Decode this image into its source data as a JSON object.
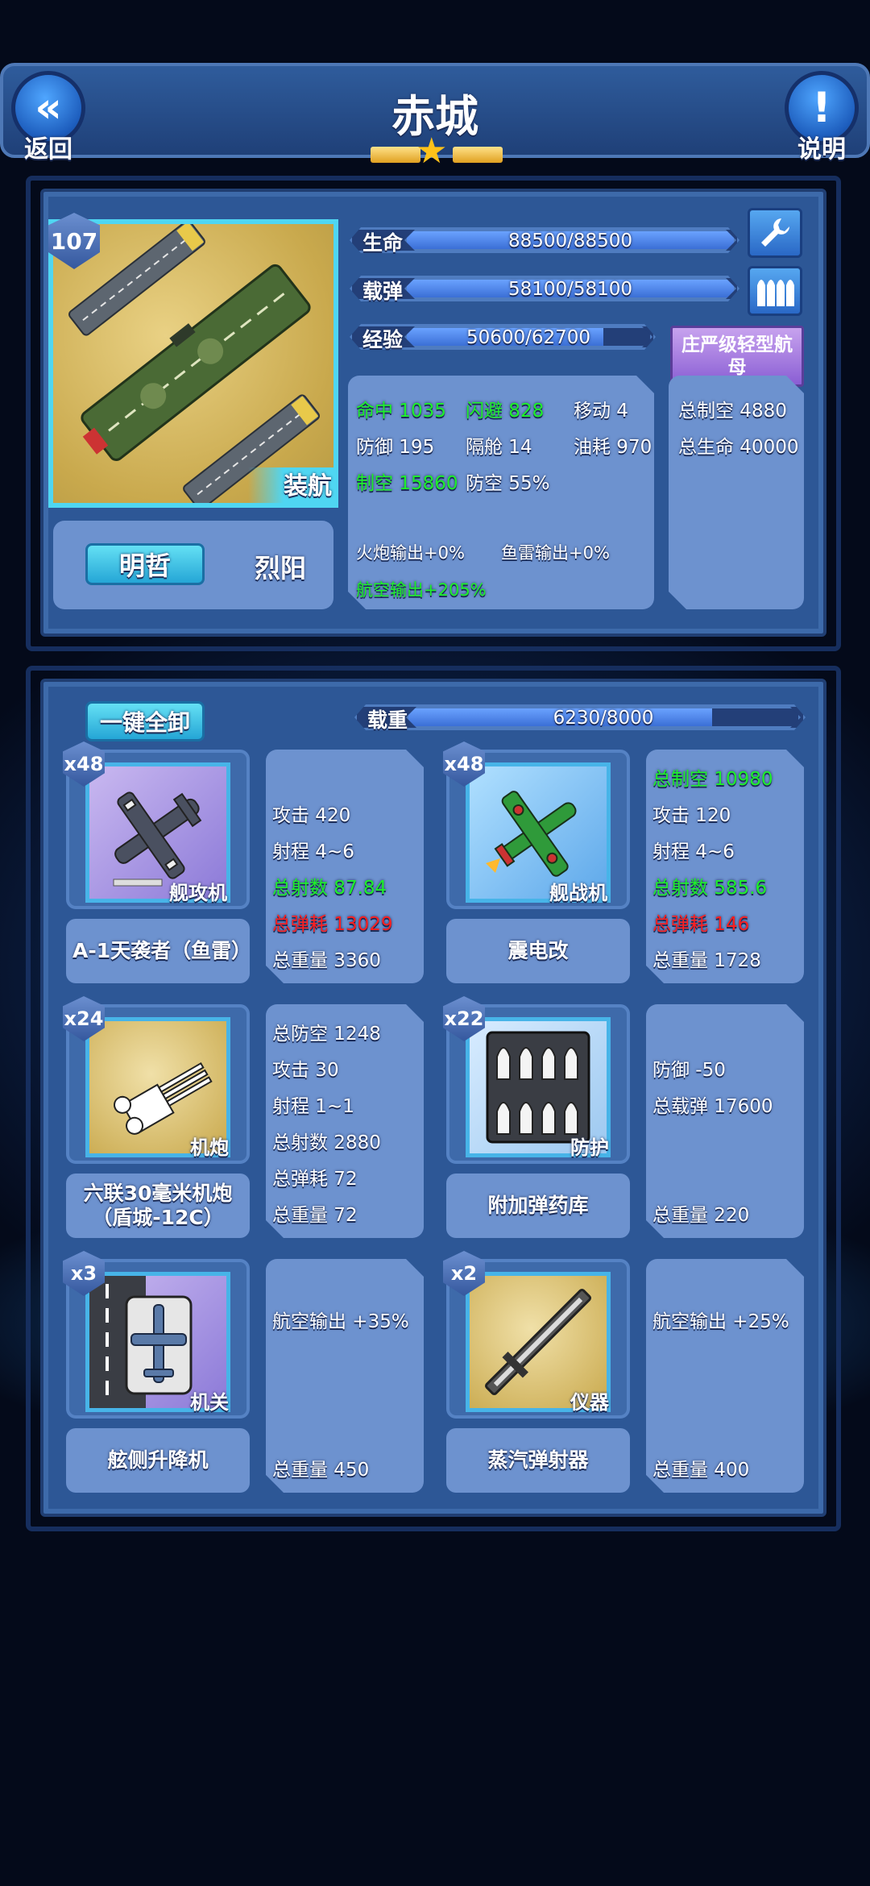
{
  "header": {
    "back_label": "返回",
    "title": "赤城",
    "help_label": "说明",
    "stars": 1
  },
  "ship": {
    "level": "107",
    "type_tag": "装航",
    "captain_btn": "明哲",
    "captain_name": "烈阳",
    "bars": {
      "hp": {
        "label": "生命",
        "text": "88500/88500",
        "fill": 1.0
      },
      "ammo": {
        "label": "载弹",
        "text": "58100/58100",
        "fill": 1.0
      },
      "exp": {
        "label": "经验",
        "text": "50600/62700",
        "fill": 0.807
      }
    },
    "class_btn": "庄严级轻型航母",
    "stats": {
      "hit": "命中 1035",
      "evade": "闪避 828",
      "move": "移动 4",
      "def": "防御 195",
      "bulkhead": "隔舱 14",
      "fuel": "油耗 970",
      "air": "制空 15860",
      "aa": "防空 55%",
      "gun_out": "火炮输出+0%",
      "torp_out": "鱼雷输出+0%",
      "air_out": "航空输出+205%"
    },
    "fleet": {
      "total_air": "总制空 4880",
      "total_hp": "总生命 40000"
    }
  },
  "loadout": {
    "unload_label": "一键全卸",
    "weight": {
      "label": "载重",
      "text": "6230/8000",
      "fill": 0.779
    },
    "items": [
      {
        "count": "x48",
        "category": "舰攻机",
        "name": "A-1天袭者（鱼雷）",
        "icon": "torpedo-bomber-icon",
        "stats": [
          {
            "t": "攻击 420",
            "c": ""
          },
          {
            "t": "射程 4~6",
            "c": ""
          },
          {
            "t": "总射数 87.84",
            "c": "g"
          },
          {
            "t": "总弹耗 13029",
            "c": "r"
          },
          {
            "t": "总重量 3360",
            "c": ""
          }
        ]
      },
      {
        "count": "x48",
        "category": "舰战机",
        "name": "震电改",
        "icon": "fighter-icon",
        "stats": [
          {
            "t": "总制空 10980",
            "c": "g"
          },
          {
            "t": "攻击 120",
            "c": ""
          },
          {
            "t": "射程 4~6",
            "c": ""
          },
          {
            "t": "总射数 585.6",
            "c": "g"
          },
          {
            "t": "总弹耗 146",
            "c": "r"
          },
          {
            "t": "总重量 1728",
            "c": ""
          }
        ]
      },
      {
        "count": "x24",
        "category": "机炮",
        "name": "六联30毫米机炮（盾城-12C）",
        "icon": "autocannon-icon",
        "stats": [
          {
            "t": "总防空 1248",
            "c": ""
          },
          {
            "t": "攻击 30",
            "c": ""
          },
          {
            "t": "射程 1~1",
            "c": ""
          },
          {
            "t": "总射数 2880",
            "c": ""
          },
          {
            "t": "总弹耗 72",
            "c": ""
          },
          {
            "t": "总重量 72",
            "c": ""
          }
        ]
      },
      {
        "count": "x22",
        "category": "防护",
        "name": "附加弹药库",
        "icon": "magazine-icon",
        "stats": [
          {
            "t": "防御 -50",
            "c": ""
          },
          {
            "t": "总载弹 17600",
            "c": ""
          },
          {
            "t": "总重量 220",
            "c": ""
          }
        ]
      },
      {
        "count": "x3",
        "category": "机关",
        "name": "舷侧升降机",
        "icon": "elevator-icon",
        "stats": [
          {
            "t": "航空输出 +35%",
            "c": ""
          },
          {
            "t": "总重量 450",
            "c": ""
          }
        ]
      },
      {
        "count": "x2",
        "category": "仪器",
        "name": "蒸汽弹射器",
        "icon": "catapult-icon",
        "stats": [
          {
            "t": "航空输出 +25%",
            "c": ""
          },
          {
            "t": "总重量 400",
            "c": ""
          }
        ]
      }
    ]
  }
}
